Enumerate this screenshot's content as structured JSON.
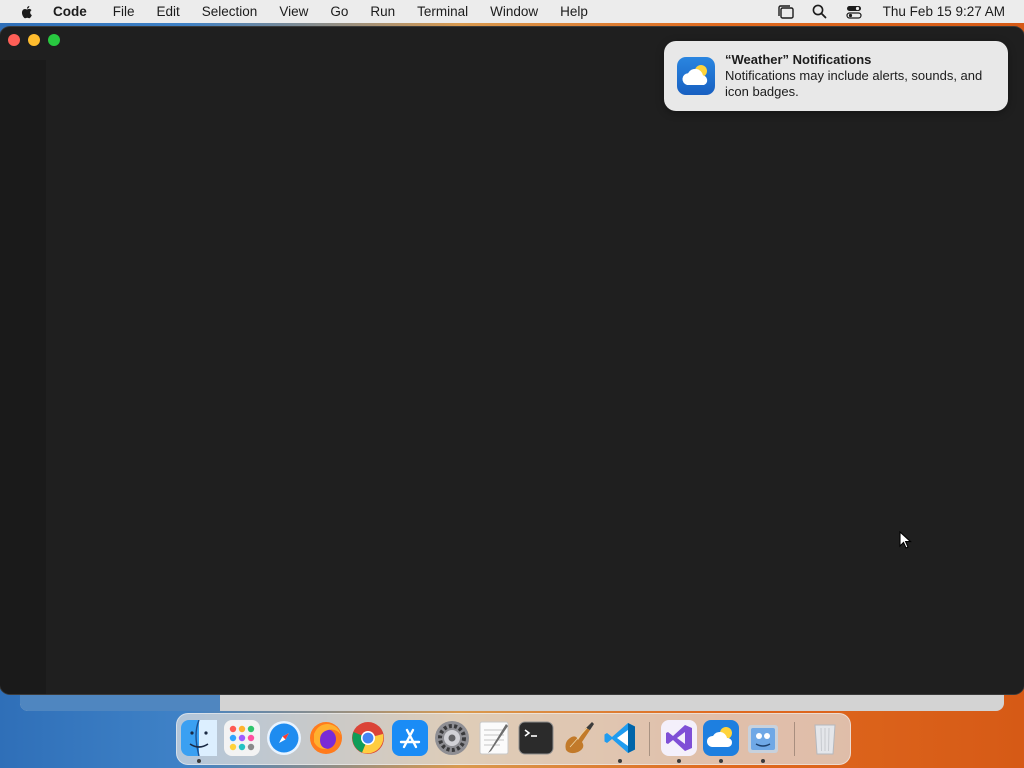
{
  "menubar": {
    "app_name": "Code",
    "items": [
      "File",
      "Edit",
      "Selection",
      "View",
      "Go",
      "Run",
      "Terminal",
      "Window",
      "Help"
    ],
    "clock": "Thu Feb 15  9:27 AM"
  },
  "notification": {
    "title": "“Weather” Notifications",
    "body": "Notifications may include alerts, sounds, and icon badges.",
    "icon": "weather-icon"
  },
  "window": {
    "app": "Visual Studio Code",
    "traffic_lights": [
      "close",
      "minimize",
      "maximize"
    ],
    "background_color": "#1e1e1e"
  },
  "dock": {
    "items": [
      {
        "name": "Finder",
        "icon": "finder-icon",
        "running": true
      },
      {
        "name": "Launchpad",
        "icon": "launchpad-icon",
        "running": false
      },
      {
        "name": "Safari",
        "icon": "safari-icon",
        "running": false
      },
      {
        "name": "Firefox",
        "icon": "firefox-icon",
        "running": false
      },
      {
        "name": "Chrome",
        "icon": "chrome-icon",
        "running": false
      },
      {
        "name": "App Store",
        "icon": "app-store-icon",
        "running": false
      },
      {
        "name": "System Settings",
        "icon": "settings-icon",
        "running": false
      },
      {
        "name": "TextEdit",
        "icon": "textedit-icon",
        "running": false
      },
      {
        "name": "Terminal",
        "icon": "terminal-icon",
        "running": false
      },
      {
        "name": "Instruments",
        "icon": "instruments-icon",
        "running": false
      },
      {
        "name": "Visual Studio Code",
        "icon": "vscode-icon",
        "running": true
      },
      {
        "name": "Visual Studio",
        "icon": "visual-studio-icon",
        "running": true
      },
      {
        "name": "Weather",
        "icon": "weather-icon",
        "running": true
      },
      {
        "name": "Preview",
        "icon": "preview-icon",
        "running": true
      },
      {
        "name": "Trash",
        "icon": "trash-icon",
        "running": false
      }
    ]
  },
  "colors": {
    "menubar": "#ececec",
    "close": "#fe5f57",
    "minimize": "#febc2e",
    "maximize": "#28c840",
    "notification_bg": "#e8e8e8"
  }
}
